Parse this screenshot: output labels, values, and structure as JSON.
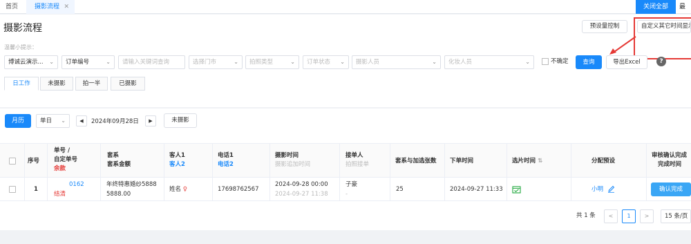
{
  "tabs": {
    "home": "首页",
    "active": "摄影流程",
    "close": "✕"
  },
  "topbar": {
    "close_all": "关闭全部",
    "more": "最"
  },
  "page": {
    "title": "摄影流程",
    "tip": "温馨小提示："
  },
  "toolbar": {
    "preset_control": "预设量控制",
    "custom_time": "自定义其它时间显示"
  },
  "filters": {
    "store": "博诚云演示...",
    "order_field": "订单编号",
    "keyword_placeholder": "请输入关键词查询",
    "select_store": "选择门市",
    "shoot_type": "拍照类型",
    "order_status": "订单状态",
    "photographer": "摄影人员",
    "makeup_artist": "化妆人员",
    "uncertain_label": "不确定",
    "query": "查询",
    "export": "导出Excel",
    "help": "?"
  },
  "subtabs": [
    "日工作",
    "未摄影",
    "拍一半",
    "已摄影"
  ],
  "calendar": {
    "month_btn": "月历",
    "mode": "单日",
    "prev": "◀",
    "next": "▶",
    "date": "2024年09月28日",
    "not_shot": "未摄影"
  },
  "table": {
    "headers": {
      "seq": "序号",
      "order_no": "单号 /",
      "custom_no": "自定单号",
      "balance": "余款",
      "package": "套系",
      "package_amount": "套系金额",
      "guest1": "客人1",
      "guest2": "客人2",
      "phone1": "电话1",
      "phone2": "电话2",
      "shoot_time": "摄影时间",
      "retake_time": "摄影追加时间",
      "receiver": "接单人",
      "shoot_handler": "拍照接单",
      "extra_count": "套系与加选张数",
      "order_time": "下单时间",
      "select_time": "选片时间",
      "assign": "分配预设",
      "review_done": "审核确认完成",
      "done_time": "完成时间"
    },
    "rows": [
      {
        "seq": "1",
        "order_no": "0162",
        "status": "结清",
        "package": "年终特惠婚纱5888",
        "amount": "5888.00",
        "guest": "姓名",
        "phone": "17698762567",
        "shoot_time": "2024-09-28 00:00",
        "retake_time": "2024-09-27 11:38",
        "receiver": "子豪",
        "receiver2": "-",
        "count": "25",
        "order_time": "2024-09-27 11:33",
        "assign": "小明",
        "confirm": "确认完成"
      }
    ]
  },
  "pager": {
    "total": "共 1 条",
    "prev": "<",
    "page": "1",
    "next": ">",
    "size": "15 条/页"
  }
}
